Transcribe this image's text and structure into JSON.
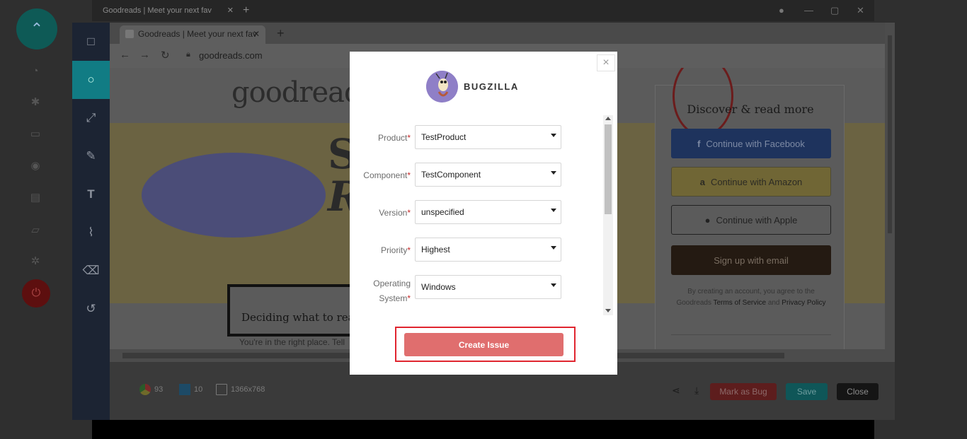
{
  "outer_window": {
    "tab_title": "Goodreads | Meet your next fav",
    "close_glyph": "✕",
    "new_tab_glyph": "+"
  },
  "browser": {
    "tab_title": "Goodreads | Meet your next fav",
    "url": "goodreads.com"
  },
  "page": {
    "logo": "goodreads",
    "hero_line_1": "S",
    "hero_line_2": "R",
    "decide_heading": "Deciding what to read",
    "decide_sub": "You're in the right place. Tell",
    "signup_heading": "Discover & read more",
    "facebook_button": "Continue with Facebook",
    "amazon_button": "Continue with Amazon",
    "apple_button": "Continue with Apple",
    "email_button": "Sign up with email",
    "terms_prefix": "By creating an account, you agree to the Goodreads",
    "terms_link": "Terms of Service",
    "terms_and": "and",
    "privacy_link": "Privacy Policy"
  },
  "footer": {
    "browser_version": "93",
    "os_version": "10",
    "resolution": "1366x768",
    "mark_as_bug": "Mark as Bug",
    "save": "Save",
    "close": "Close"
  },
  "modal": {
    "brand": "BUGZILLA",
    "close_glyph": "×",
    "fields": [
      {
        "label": "Product",
        "value": "TestProduct",
        "required": true
      },
      {
        "label": "Component",
        "value": "TestComponent",
        "required": true
      },
      {
        "label": "Version",
        "value": "unspecified",
        "required": true
      },
      {
        "label": "Priority",
        "value": "Highest",
        "required": true
      },
      {
        "label_line_1": "Operating",
        "label_line_2": "System",
        "value": "Windows",
        "required": true
      }
    ],
    "required_mark": "*",
    "create_button": "Create Issue"
  },
  "colors": {
    "accent_teal": "#117c84",
    "create_button": "#e06e6e",
    "highlight_outline": "#e0252f"
  }
}
